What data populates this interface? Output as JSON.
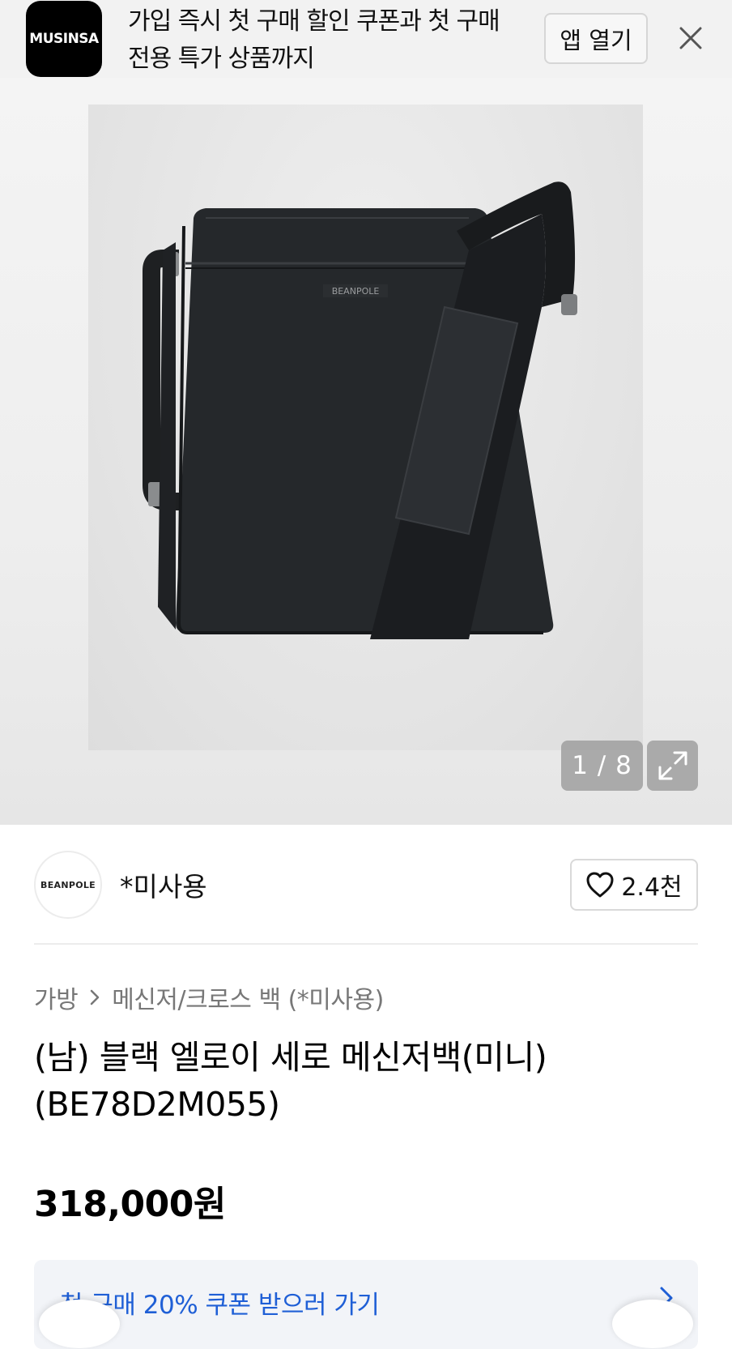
{
  "app_banner": {
    "logo_text": "MUSINSA",
    "message": "가입 즉시 첫 구매 할인 쿠폰과 첫 구매 전용 특가 상품까지",
    "open_app_label": "앱 열기",
    "close_icon": "close-icon"
  },
  "gallery": {
    "product_logo_text": "BEANPOLE",
    "counter": "1 / 8",
    "expand_icon": "expand-icon"
  },
  "brand": {
    "avatar_text": "BEANPOLE",
    "name": "*미사용",
    "like_count": "2.4천",
    "like_icon": "heart-icon"
  },
  "product": {
    "breadcrumb": [
      "가방",
      "메신저/크로스 백 (*미사용)"
    ],
    "title": "(남) 블랙 엘로이 세로 메신저백(미니) (BE78D2M055)",
    "price": "318,000원"
  },
  "coupon": {
    "label": "첫 구매 20% 쿠폰 받으러 가기",
    "link_color": "#1f5fd6"
  },
  "colors": {
    "banner_bg": "#f2f2f2",
    "text": "#111111",
    "muted": "#777777"
  }
}
